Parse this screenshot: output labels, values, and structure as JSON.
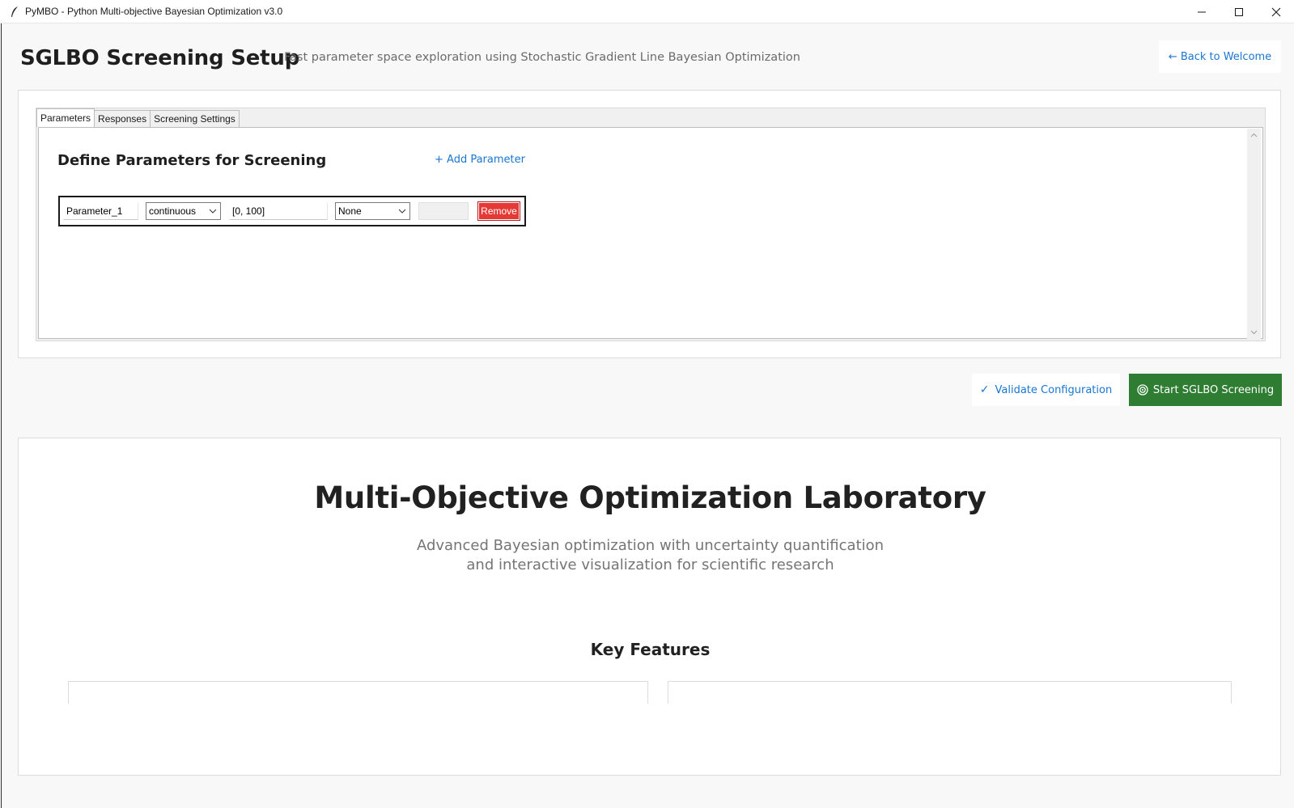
{
  "window": {
    "title": "PyMBO - Python Multi-objective Bayesian Optimization v3.0",
    "app_icon": "feather-icon",
    "controls": [
      "minimize-icon",
      "maximize-icon",
      "close-icon"
    ]
  },
  "header": {
    "title": "SGLBO Screening Setup",
    "subtitle": "Fast parameter space exploration using Stochastic Gradient Line Bayesian Optimization",
    "back_label": "← Back to Welcome"
  },
  "tabs": [
    {
      "label": "Parameters",
      "active": true
    },
    {
      "label": "Responses",
      "active": false
    },
    {
      "label": "Screening Settings",
      "active": false
    }
  ],
  "parameters_panel": {
    "title": "Define Parameters for Screening",
    "add_label": "+ Add Parameter",
    "rows": [
      {
        "name": "Parameter_1",
        "type": "continuous",
        "range": "[0, 100]",
        "transform": "None",
        "extra": "",
        "remove_label": "Remove"
      }
    ]
  },
  "actions": {
    "validate_label": "Validate Configuration",
    "validate_icon": "✓",
    "start_label": "Start SGLBO Screening",
    "start_icon": "target-icon"
  },
  "lab": {
    "title": "Multi-Objective Optimization Laboratory",
    "subtitle_line1": "Advanced Bayesian optimization with uncertainty quantification",
    "subtitle_line2": "and interactive visualization for scientific research",
    "features_title": "Key Features"
  },
  "colors": {
    "accent_blue": "#1976d2",
    "start_green": "#2e7d32",
    "remove_red": "#e53935",
    "background": "#f8f8f8"
  }
}
